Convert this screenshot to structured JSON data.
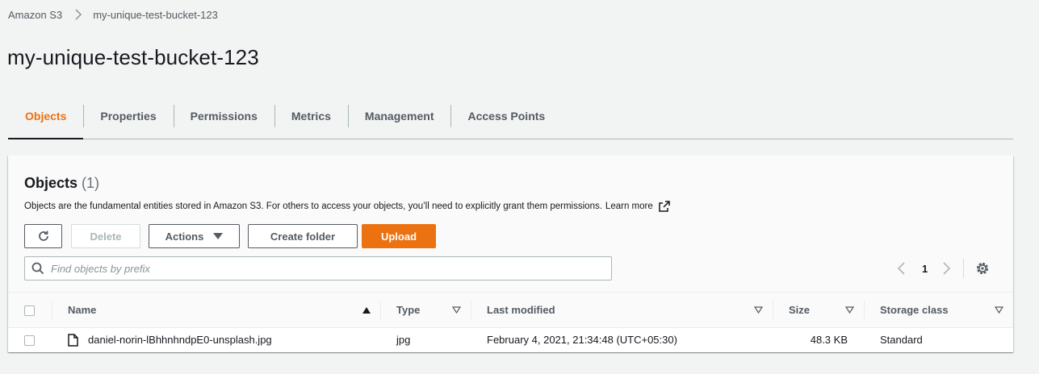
{
  "breadcrumb": {
    "root": "Amazon S3",
    "current": "my-unique-test-bucket-123"
  },
  "page": {
    "title": "my-unique-test-bucket-123"
  },
  "tabs": [
    {
      "label": "Objects",
      "active": true
    },
    {
      "label": "Properties",
      "active": false
    },
    {
      "label": "Permissions",
      "active": false
    },
    {
      "label": "Metrics",
      "active": false
    },
    {
      "label": "Management",
      "active": false
    },
    {
      "label": "Access Points",
      "active": false
    }
  ],
  "objects_panel": {
    "title": "Objects",
    "count": "(1)",
    "description": "Objects are the fundamental entities stored in Amazon S3. For others to access your objects, you’ll need to explicitly grant them permissions.",
    "learn_more": "Learn more",
    "buttons": {
      "refresh_icon": "refresh-icon",
      "delete": "Delete",
      "actions": "Actions",
      "create_folder": "Create folder",
      "upload": "Upload"
    },
    "search": {
      "placeholder": "Find objects by prefix",
      "value": ""
    },
    "pagination": {
      "current_page": "1"
    }
  },
  "table": {
    "columns": [
      "Name",
      "Type",
      "Last modified",
      "Size",
      "Storage class"
    ],
    "rows": [
      {
        "name": "daniel-norin-lBhhnhndpE0-unsplash.jpg",
        "type": "jpg",
        "last_modified": "February 4, 2021, 21:34:48 (UTC+05:30)",
        "size": "48.3 KB",
        "storage_class": "Standard"
      }
    ]
  },
  "colors": {
    "accent": "#ec7211",
    "text": "#16191f",
    "muted": "#545b64",
    "background": "#f2f3f3"
  }
}
